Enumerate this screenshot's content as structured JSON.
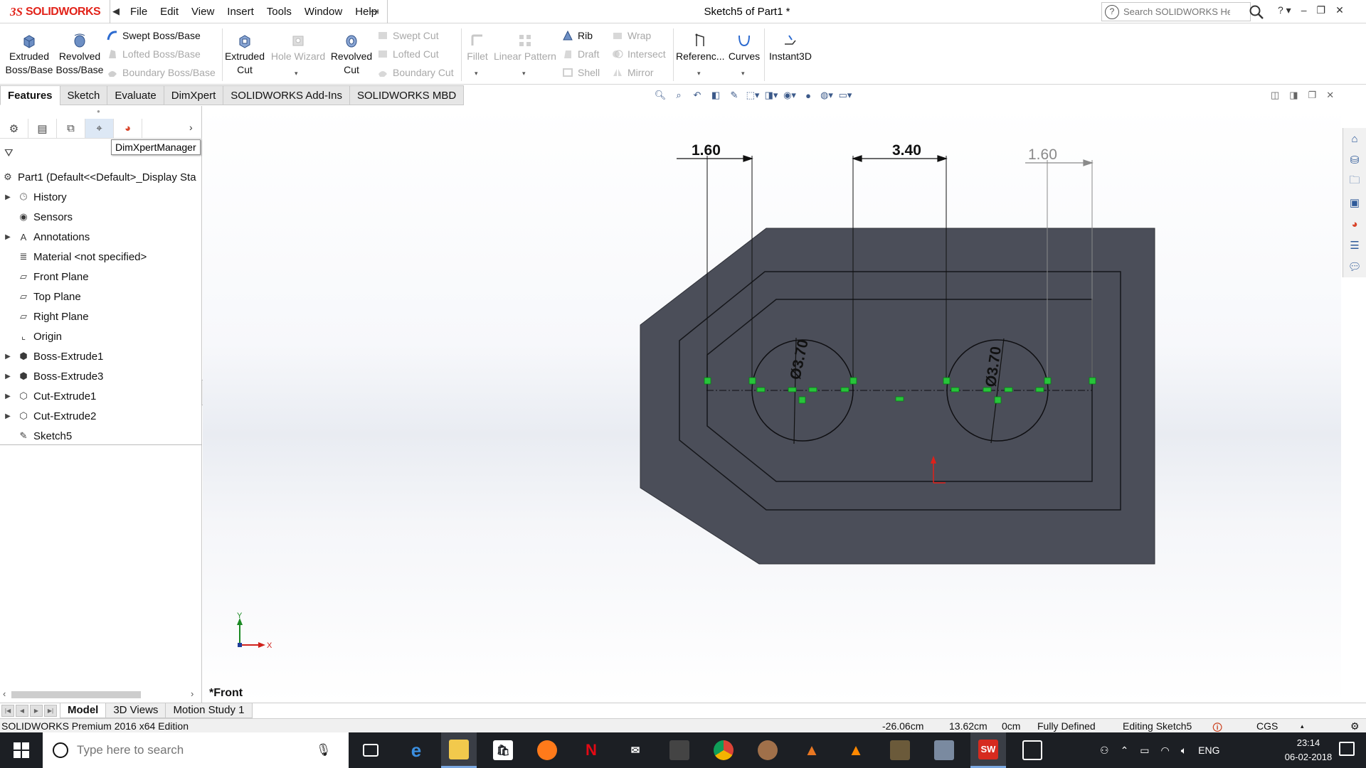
{
  "app": {
    "logo_prefix": "3S",
    "logo_text": "SOLIDWORKS",
    "document_title": "Sketch5 of Part1 *",
    "menu": [
      "File",
      "Edit",
      "View",
      "Insert",
      "Tools",
      "Window",
      "Help"
    ],
    "help_search_placeholder": "Search SOLIDWORKS Help"
  },
  "commands": {
    "extruded_boss": "Extruded Boss/Base",
    "revolved_boss": "Revolved Boss/Base",
    "swept_boss": "Swept Boss/Base",
    "lofted_boss": "Lofted Boss/Base",
    "boundary_boss": "Boundary Boss/Base",
    "extruded_cut": "Extruded Cut",
    "hole_wizard": "Hole Wizard",
    "revolved_cut": "Revolved Cut",
    "swept_cut": "Swept Cut",
    "lofted_cut": "Lofted Cut",
    "boundary_cut": "Boundary Cut",
    "fillet": "Fillet",
    "linear_pattern": "Linear Pattern",
    "rib": "Rib",
    "draft": "Draft",
    "shell": "Shell",
    "wrap": "Wrap",
    "intersect": "Intersect",
    "mirror": "Mirror",
    "reference": "Referenc...",
    "curves": "Curves",
    "instant3d": "Instant3D"
  },
  "tabs": [
    "Features",
    "Sketch",
    "Evaluate",
    "DimXpert",
    "SOLIDWORKS Add-Ins",
    "SOLIDWORKS MBD"
  ],
  "active_tab": "Features",
  "panel": {
    "tooltip": "DimXpertManager",
    "tree": [
      {
        "label": "Part1  (Default<<Default>_Display Sta",
        "icon": "part-icon",
        "expandable": false
      },
      {
        "label": "History",
        "icon": "history-icon",
        "expandable": true
      },
      {
        "label": "Sensors",
        "icon": "sensor-icon",
        "expandable": false
      },
      {
        "label": "Annotations",
        "icon": "annotation-icon",
        "expandable": true
      },
      {
        "label": "Material <not specified>",
        "icon": "material-icon",
        "expandable": false
      },
      {
        "label": "Front Plane",
        "icon": "plane-icon",
        "expandable": false
      },
      {
        "label": "Top Plane",
        "icon": "plane-icon",
        "expandable": false
      },
      {
        "label": "Right Plane",
        "icon": "plane-icon",
        "expandable": false
      },
      {
        "label": "Origin",
        "icon": "origin-icon",
        "expandable": false
      },
      {
        "label": "Boss-Extrude1",
        "icon": "extrude-icon",
        "expandable": true
      },
      {
        "label": "Boss-Extrude3",
        "icon": "extrude-icon",
        "expandable": true
      },
      {
        "label": "Cut-Extrude1",
        "icon": "cut-icon",
        "expandable": true
      },
      {
        "label": "Cut-Extrude2",
        "icon": "cut-icon",
        "expandable": true
      },
      {
        "label": "Sketch5",
        "icon": "sketch-icon",
        "expandable": false
      }
    ]
  },
  "graphics": {
    "view_label": "*Front",
    "dimensions": [
      "1.60",
      "3.40",
      "1.60",
      "Ø3.70",
      "Ø3.70"
    ],
    "triad_x": "X",
    "triad_y": "Y",
    "colors": {
      "part_face": "#4b4e59",
      "sketch_relation": "#27c43a",
      "dimension": "#111111"
    }
  },
  "bottom_tabs": [
    "Model",
    "3D Views",
    "Motion Study 1"
  ],
  "active_bottom_tab": "Model",
  "status": {
    "edition": "SOLIDWORKS Premium 2016 x64 Edition",
    "x": "-26.06cm",
    "y": "13.62cm",
    "z": "0cm",
    "state": "Fully Defined",
    "editing": "Editing Sketch5",
    "units": "CGS"
  },
  "taskbar": {
    "search_placeholder": "Type here to search",
    "language": "ENG",
    "time": "23:14",
    "date": "06-02-2018",
    "sw_badge": "SW"
  }
}
